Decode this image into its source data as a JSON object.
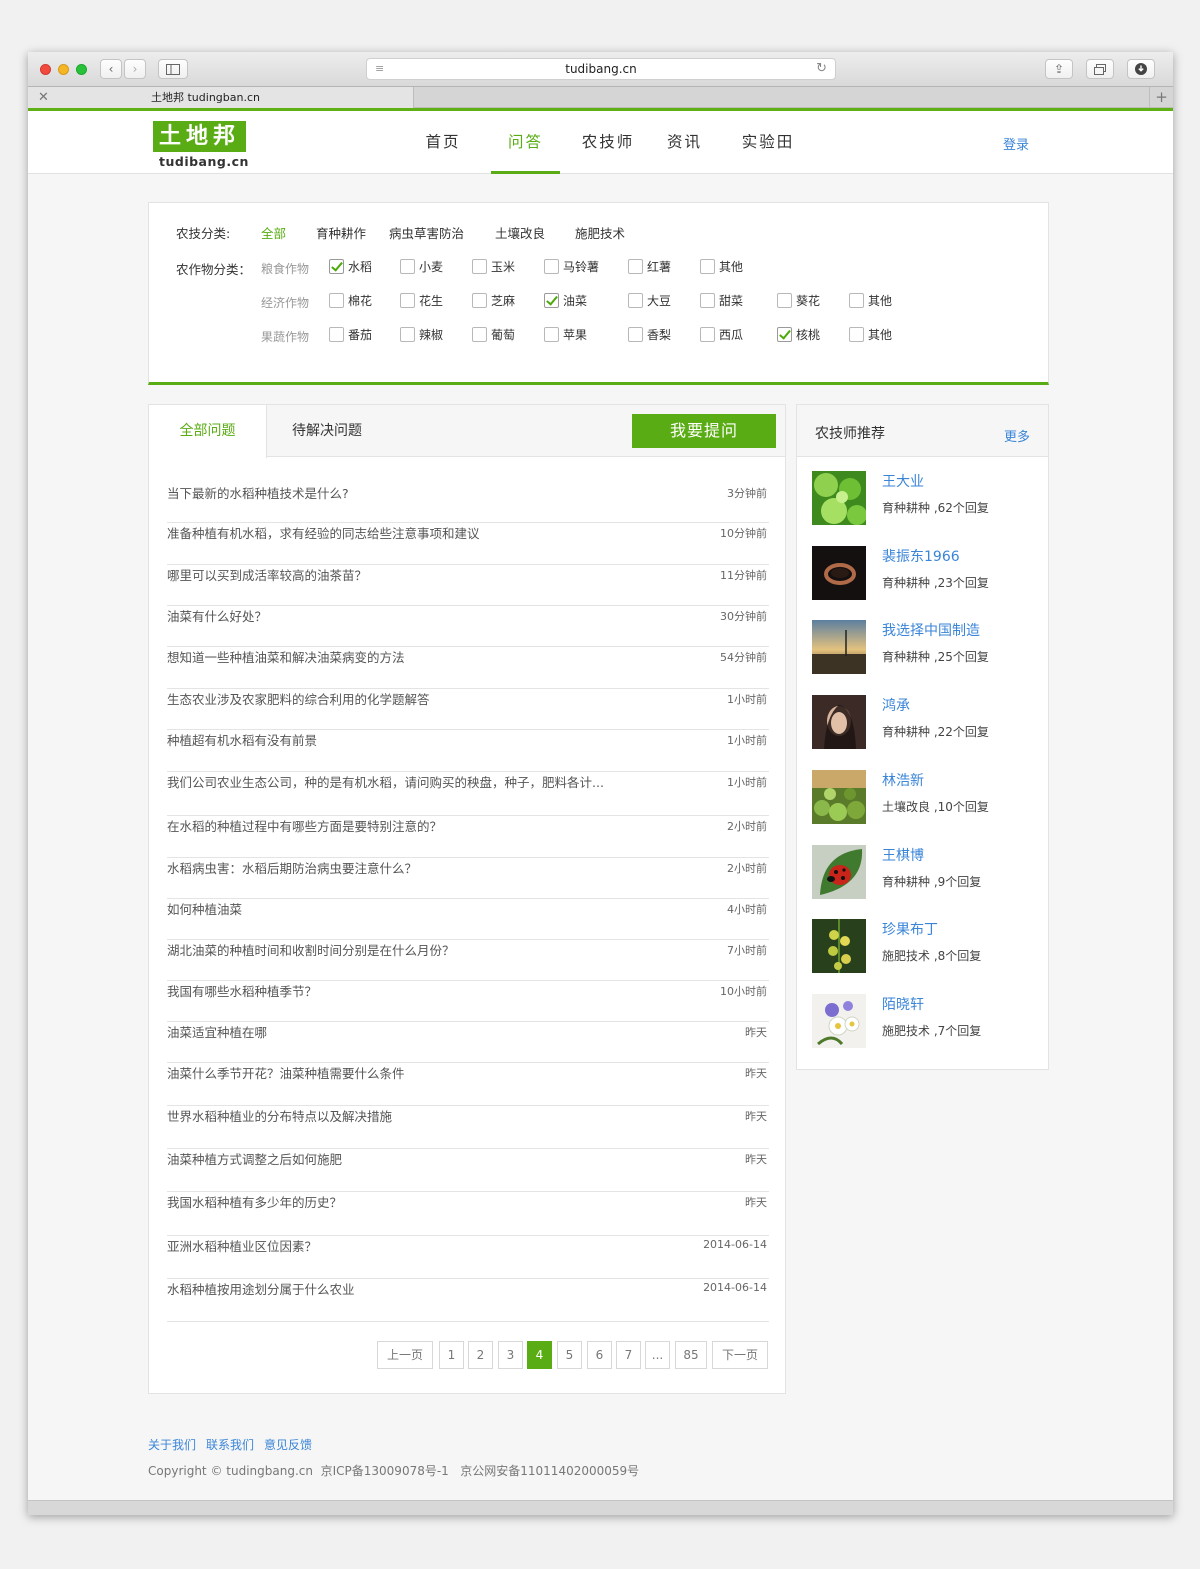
{
  "browser": {
    "url": "tudibang.cn",
    "tab_title": "土地邦 tudingban.cn"
  },
  "logo": {
    "name": "土地邦",
    "domain": "tudibang.cn"
  },
  "nav": {
    "items": [
      "首页",
      "问答",
      "农技师",
      "资讯",
      "实验田"
    ],
    "active": "问答",
    "login": "登录"
  },
  "filter": {
    "tech_label": "农技分类:",
    "tech": [
      "全部",
      "育种耕作",
      "病虫草害防治",
      "土壤改良",
      "施肥技术"
    ],
    "crop_label": "农作物分类：",
    "groups": [
      {
        "name": "粮食作物",
        "items": [
          {
            "label": "水稻",
            "checked": true
          },
          {
            "label": "小麦",
            "checked": false
          },
          {
            "label": "玉米",
            "checked": false
          },
          {
            "label": "马铃薯",
            "checked": false
          },
          {
            "label": "红薯",
            "checked": false
          },
          {
            "label": "其他",
            "checked": false
          }
        ]
      },
      {
        "name": "经济作物",
        "items": [
          {
            "label": "棉花",
            "checked": false
          },
          {
            "label": "花生",
            "checked": false
          },
          {
            "label": "芝麻",
            "checked": false
          },
          {
            "label": "油菜",
            "checked": true
          },
          {
            "label": "大豆",
            "checked": false
          },
          {
            "label": "甜菜",
            "checked": false
          },
          {
            "label": "葵花",
            "checked": false
          },
          {
            "label": "其他",
            "checked": false
          }
        ]
      },
      {
        "name": "果蔬作物",
        "items": [
          {
            "label": "番茄",
            "checked": false
          },
          {
            "label": "辣椒",
            "checked": false
          },
          {
            "label": "葡萄",
            "checked": false
          },
          {
            "label": "苹果",
            "checked": false
          },
          {
            "label": "香梨",
            "checked": false
          },
          {
            "label": "西瓜",
            "checked": false
          },
          {
            "label": "核桃",
            "checked": true
          },
          {
            "label": "其他",
            "checked": false
          }
        ]
      }
    ]
  },
  "questions": {
    "tabs": [
      "全部问题",
      "待解决问题"
    ],
    "ask_button": "我要提问",
    "items": [
      {
        "title": "当下最新的水稻种植技术是什么?",
        "time": "3分钟前"
      },
      {
        "title": "准备种植有机水稻，求有经验的同志给些注意事项和建议",
        "time": "10分钟前"
      },
      {
        "title": "哪里可以买到成活率较高的油茶苗？",
        "time": "11分钟前"
      },
      {
        "title": "油菜有什么好处？",
        "time": "30分钟前"
      },
      {
        "title": "想知道一些种植油菜和解决油菜病变的方法",
        "time": "54分钟前"
      },
      {
        "title": "生态农业涉及农家肥料的综合利用的化学题解答",
        "time": "1小时前"
      },
      {
        "title": "种植超有机水稻有没有前景",
        "time": "1小时前"
      },
      {
        "title": "我们公司农业生态公司，种的是有机水稻，请问购买的秧盘，种子，肥料各计...",
        "time": "1小时前"
      },
      {
        "title": "在水稻的种植过程中有哪些方面是要特别注意的？",
        "time": "2小时前"
      },
      {
        "title": "水稻病虫害：水稻后期防治病虫要注意什么？",
        "time": "2小时前"
      },
      {
        "title": "如何种植油菜",
        "time": "4小时前"
      },
      {
        "title": "湖北油菜的种植时间和收割时间分别是在什么月份？",
        "time": "7小时前"
      },
      {
        "title": "我国有哪些水稻种植季节？",
        "time": "10小时前"
      },
      {
        "title": "油菜适宜种植在哪",
        "time": "昨天"
      },
      {
        "title": "油菜什么季节开花？油菜种植需要什么条件",
        "time": "昨天"
      },
      {
        "title": "世界水稻种植业的分布特点以及解决措施",
        "time": "昨天"
      },
      {
        "title": "油菜种植方式调整之后如何施肥",
        "time": "昨天"
      },
      {
        "title": "我国水稻种植有多少年的历史？",
        "time": "昨天"
      },
      {
        "title": "亚洲水稻种植业区位因素？",
        "time": "2014-06-14"
      },
      {
        "title": "水稻种植按用途划分属于什么农业",
        "time": "2014-06-14"
      }
    ]
  },
  "pagination": {
    "prev": "上一页",
    "pages": [
      "1",
      "2",
      "3",
      "4",
      "5",
      "6",
      "7",
      "...",
      "85"
    ],
    "current": "4",
    "next": "下一页"
  },
  "sidebar": {
    "title": "农技师推荐",
    "more": "更多",
    "experts": [
      {
        "name": "王大业",
        "info": "育种耕种 ,62个回复",
        "avatar": "green-leaves"
      },
      {
        "name": "裴振东1966",
        "info": "育种耕种 ,23个回复",
        "avatar": "ring"
      },
      {
        "name": "我选择中国制造",
        "info": "育种耕种 ,25个回复",
        "avatar": "sunset-road"
      },
      {
        "name": "鸿承",
        "info": "育种耕种 ,22个回复",
        "avatar": "portrait"
      },
      {
        "name": "林浩新",
        "info": "土壤改良 ,10个回复",
        "avatar": "vegetables"
      },
      {
        "name": "王棋博",
        "info": "育种耕种 ,9个回复",
        "avatar": "ladybug"
      },
      {
        "name": "珍果布丁",
        "info": "施肥技术 ,8个回复",
        "avatar": "yellow-flowers"
      },
      {
        "name": "陌晓轩",
        "info": "施肥技术 ,7个回复",
        "avatar": "white-flowers"
      }
    ]
  },
  "footer": {
    "links": [
      "关于我们",
      "联系我们",
      "意见反馈"
    ],
    "copyright": "Copyright © tudingbang.cn",
    "icp": "京ICP备13009078号-1",
    "police": "京公网安备11011402000059号"
  },
  "colors": {
    "brand_green": "#5aac14",
    "link_blue": "#3a85d8"
  }
}
